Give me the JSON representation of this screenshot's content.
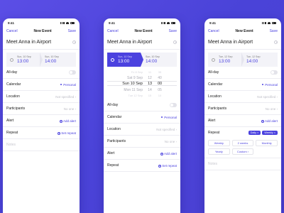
{
  "status": {
    "time": "9:41"
  },
  "nav": {
    "cancel": "Cancel",
    "title": "New Event",
    "save": "Save"
  },
  "event": {
    "title": "Meet Anna in Airport"
  },
  "dates_a": {
    "start": {
      "date": "Sun, 10 Sep",
      "time": "13:00"
    },
    "end": {
      "date": "Sun, 10 Sep",
      "time": "14:00"
    }
  },
  "dates_c": {
    "start": {
      "date": "Tue, 12 Sep",
      "time": "13:00"
    },
    "end": {
      "date": "Tue, 12 Sep",
      "time": "14:00"
    }
  },
  "picker": {
    "rows": [
      {
        "date": "Fri  8 Sep",
        "h": "11",
        "m": "35"
      },
      {
        "date": "Sat  9 Sep",
        "h": "12",
        "m": "40"
      },
      {
        "date": "Sun 10 Sep",
        "h": "13",
        "m": "00"
      },
      {
        "date": "Mon 11 Sep",
        "h": "14",
        "m": "05"
      },
      {
        "date": "Tue 12 Sep",
        "h": "15",
        "m": "10"
      }
    ]
  },
  "fields": {
    "allday": "All-day",
    "calendar": "Calendar",
    "calendar_value": "Personal",
    "location": "Location",
    "location_value": "Not specified",
    "participants": "Participants",
    "participants_value": "No one",
    "alert": "Alert",
    "alert_value": "Add alert",
    "repeat": "Repeat",
    "repeat_value": "Set repeat",
    "notes": "Notes"
  },
  "repeat_panel": {
    "selected": [
      "Daily ×",
      "Weekly ×"
    ],
    "options": [
      "Weekly",
      "2 weeks",
      "Monthly",
      "Yearly",
      "Custom  ›"
    ]
  },
  "colors": {
    "accent": "#4b42df",
    "background": "#4a43d8"
  }
}
